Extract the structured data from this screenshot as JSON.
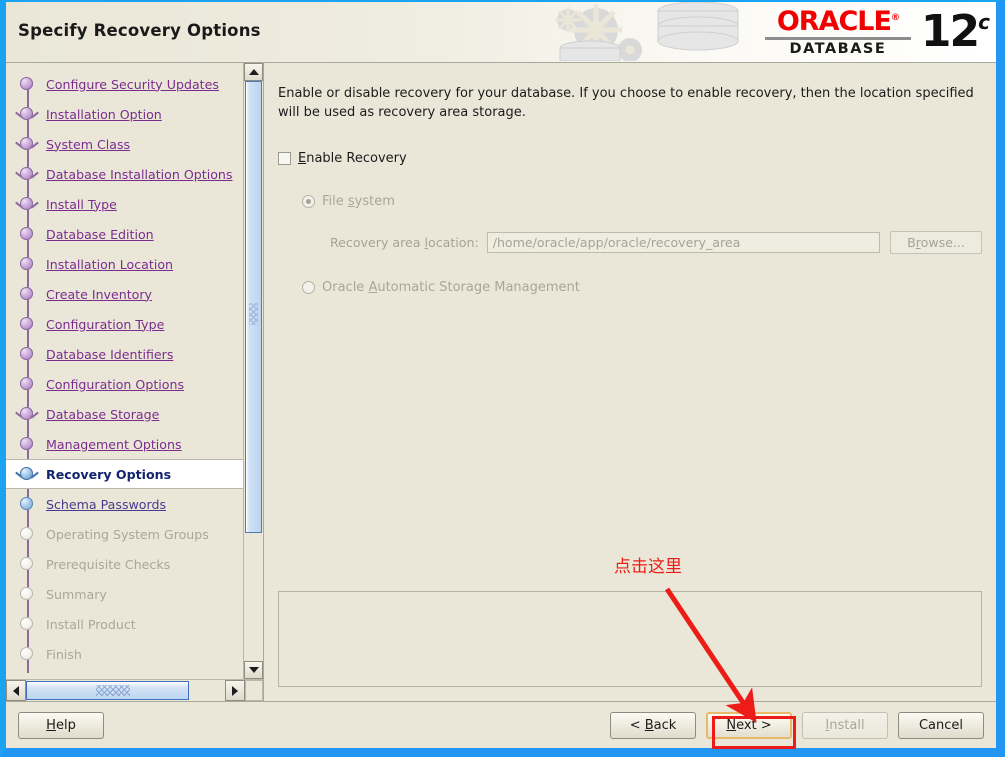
{
  "window": {
    "title": "Specify Recovery Options",
    "border_color": "#2196f3",
    "background": "#eae7d8"
  },
  "brand": {
    "oracle_word": "ORACLE",
    "registered_mark": "®",
    "database_word": "DATABASE",
    "version_number": "12",
    "version_suffix": "c",
    "oracle_red": "#f00000"
  },
  "sidebar": {
    "steps": [
      {
        "label": "Configure Security Updates",
        "state": "done"
      },
      {
        "label": "Installation Option",
        "state": "done-branch"
      },
      {
        "label": "System Class",
        "state": "done-branch"
      },
      {
        "label": "Database Installation Options",
        "state": "done-branch"
      },
      {
        "label": "Install Type",
        "state": "done-branch"
      },
      {
        "label": "Database Edition",
        "state": "done"
      },
      {
        "label": "Installation Location",
        "state": "done"
      },
      {
        "label": "Create Inventory",
        "state": "done"
      },
      {
        "label": "Configuration Type",
        "state": "done"
      },
      {
        "label": "Database Identifiers",
        "state": "done"
      },
      {
        "label": "Configuration Options",
        "state": "done"
      },
      {
        "label": "Database Storage",
        "state": "done-branch"
      },
      {
        "label": "Management Options",
        "state": "done"
      },
      {
        "label": "Recovery Options",
        "state": "active"
      },
      {
        "label": "Schema Passwords",
        "state": "upcoming"
      },
      {
        "label": "Operating System Groups",
        "state": "disabled"
      },
      {
        "label": "Prerequisite Checks",
        "state": "disabled"
      },
      {
        "label": "Summary",
        "state": "disabled"
      },
      {
        "label": "Install Product",
        "state": "disabled"
      },
      {
        "label": "Finish",
        "state": "disabled"
      }
    ],
    "link_color": "#7b2d8e",
    "active_color": "#14236e",
    "disabled_color": "#a9a79a"
  },
  "scrollbars": {
    "vertical_up_icon": "triangle-up-icon",
    "vertical_down_icon": "triangle-down-icon",
    "horizontal_left_icon": "triangle-left-icon",
    "horizontal_right_icon": "triangle-right-icon"
  },
  "main": {
    "description": "Enable or disable recovery for your database. If you choose to enable recovery, then the location specified will be used as recovery area storage.",
    "enable_recovery": {
      "label_before": "",
      "mnemonic": "E",
      "label_after": "nable Recovery",
      "checked": false
    },
    "file_system": {
      "label_before": "File ",
      "mnemonic": "s",
      "label_after": "ystem",
      "selected": true,
      "disabled": true
    },
    "recovery_area": {
      "label_before": "Recovery area ",
      "mnemonic": "l",
      "label_after": "ocation:",
      "value": "/home/oracle/app/oracle/recovery_area",
      "disabled": true
    },
    "browse_button": {
      "label_before": "B",
      "mnemonic": "r",
      "label_after": "owse...",
      "disabled": true
    },
    "asm": {
      "label_before": "Oracle ",
      "mnemonic": "A",
      "label_after": "utomatic Storage Management",
      "selected": false,
      "disabled": true
    },
    "message_panel_text": ""
  },
  "footer": {
    "help": {
      "label_before": "",
      "mnemonic": "H",
      "label_after": "elp",
      "disabled": false
    },
    "back": {
      "label_before": "< ",
      "mnemonic": "B",
      "label_after": "ack",
      "disabled": false
    },
    "next": {
      "label_before": "",
      "mnemonic": "N",
      "label_after": "ext >",
      "disabled": false,
      "focused": true
    },
    "install": {
      "label_before": "",
      "mnemonic": "I",
      "label_after": "nstall",
      "disabled": true
    },
    "cancel": {
      "label_before": "Cancel",
      "mnemonic": "",
      "label_after": "",
      "disabled": false
    }
  },
  "annotation": {
    "text": "点击这里",
    "color": "#ee1c18",
    "points_to": "next-button"
  }
}
